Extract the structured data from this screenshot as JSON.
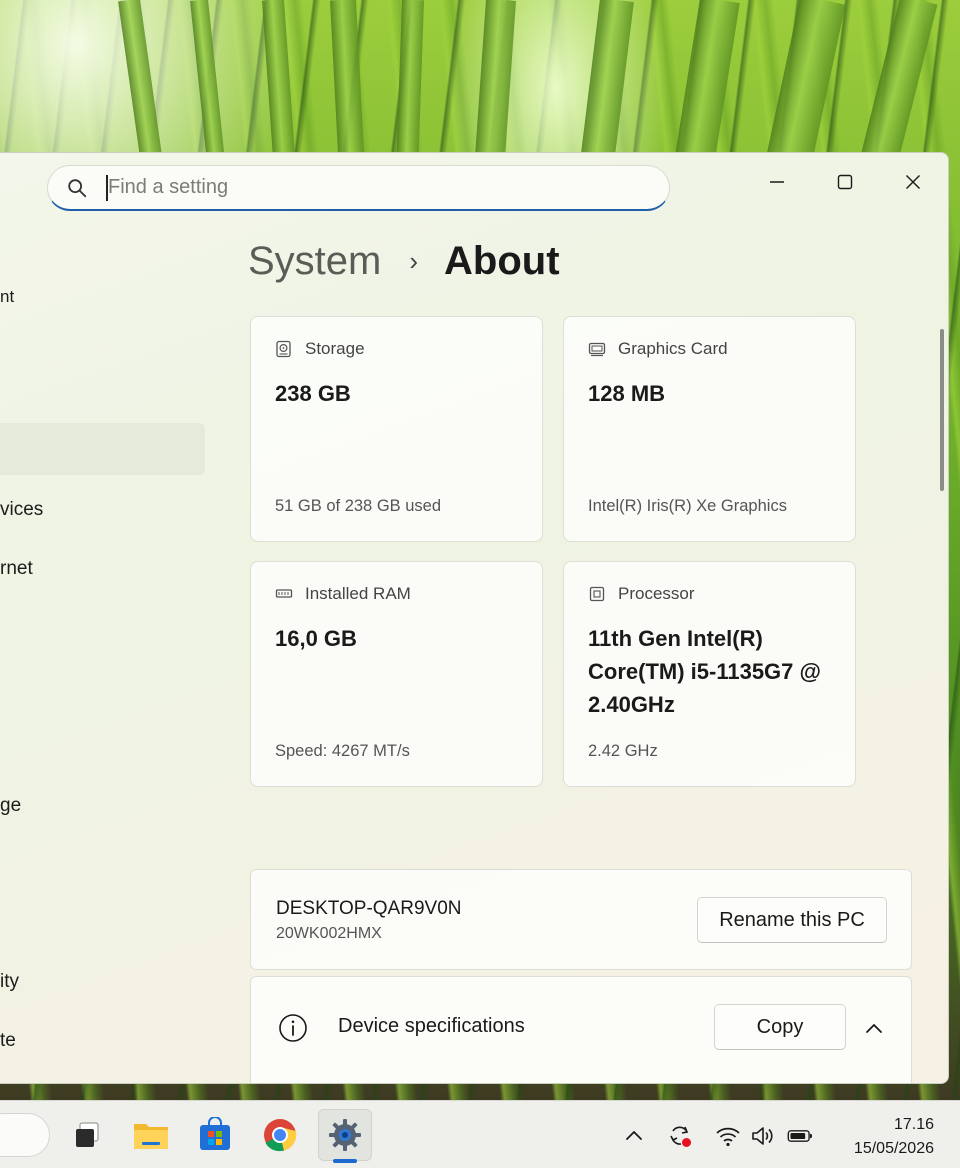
{
  "search": {
    "placeholder": "Find a setting"
  },
  "sidebar_fragments": [
    "nt",
    "vices",
    "rnet",
    "ge",
    "ity",
    "te"
  ],
  "breadcrumb": {
    "parent": "System",
    "separator": "›",
    "current": "About"
  },
  "cards": {
    "storage": {
      "label": "Storage",
      "value": "238 GB",
      "detail": "51 GB of 238 GB used",
      "icon": "storage-icon"
    },
    "graphics": {
      "label": "Graphics Card",
      "value": "128 MB",
      "detail": "Intel(R) Iris(R) Xe Graphics",
      "icon": "graphics-card-icon"
    },
    "ram": {
      "label": "Installed RAM",
      "value": "16,0 GB",
      "detail": "Speed: 4267 MT/s",
      "icon": "ram-icon"
    },
    "processor": {
      "label": "Processor",
      "value": "11th Gen Intel(R) Core(TM) i5-1135G7 @ 2.40GHz",
      "detail": "2.42 GHz",
      "icon": "processor-icon"
    }
  },
  "device": {
    "name": "DESKTOP-QAR9V0N",
    "model": "20WK002HMX",
    "rename_label": "Rename this PC"
  },
  "specs": {
    "label": "Device specifications",
    "copy_label": "Copy"
  },
  "window_controls": {
    "minimize": "—",
    "maximize": "☐",
    "close": "✕"
  },
  "taskbar": {
    "apps": [
      "task-view-icon",
      "file-explorer-icon",
      "microsoft-store-icon",
      "chrome-icon",
      "settings-icon"
    ],
    "clock_time": "17.16",
    "clock_date": "15/05/2026"
  },
  "colors": {
    "accent": "#1f5fa8",
    "taskbar_indicator": "#1f6ad0"
  }
}
